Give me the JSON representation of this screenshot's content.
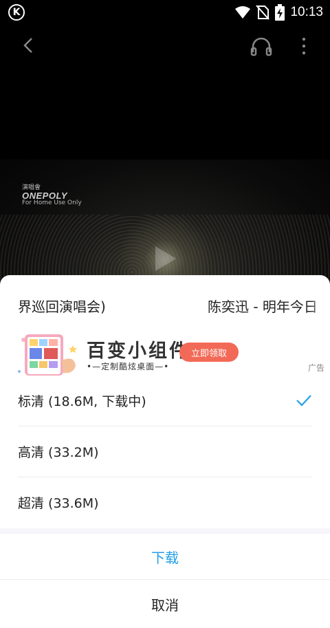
{
  "status_bar": {
    "time": "10:13",
    "left_icon": "k-circle-icon"
  },
  "video": {
    "watermark": {
      "top_line": "演唱會",
      "logo": "ONEPOLY",
      "sub": "For Home Use Only"
    }
  },
  "sheet": {
    "title_scroll": [
      "界巡回演唱会)",
      "陈奕迅 - 明年今日"
    ],
    "ad": {
      "title": "百变小组件",
      "subtitle": "•—定制酷炫桌面—•",
      "cta_label": "立即领取",
      "tag": "广告"
    },
    "options": [
      {
        "label": "标清 (18.6M, 下载中)",
        "selected": true
      },
      {
        "label": "高清 (33.2M)",
        "selected": false
      },
      {
        "label": "超清 (33.6M)",
        "selected": false
      }
    ],
    "download_label": "下载",
    "cancel_label": "取消"
  },
  "colors": {
    "accent": "#22a0e8",
    "cta": "#f26a57"
  }
}
